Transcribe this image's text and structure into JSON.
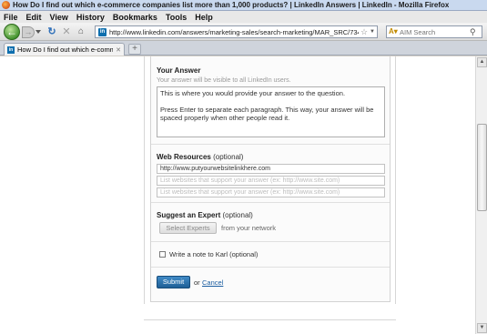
{
  "window": {
    "title": "How Do I find out which e-commerce companies list more than 1,000 products? | LinkedIn Answers | LinkedIn - Mozilla Firefox"
  },
  "menu": {
    "items": [
      "File",
      "Edit",
      "View",
      "History",
      "Bookmarks",
      "Tools",
      "Help"
    ]
  },
  "nav": {
    "url": "http://www.linkedin.com/answers/marketing-sales/search-marketing/MAR_SRC/73491:",
    "search_placeholder": "AIM Search"
  },
  "tabs": {
    "active_label": "How Do I find out which e-comm..."
  },
  "form": {
    "your_answer": {
      "title": "Your Answer",
      "hint": "Your answer will be visible to all LinkedIn users.",
      "text": "This is where you would provide your answer to the question.\n\nPress Enter to separate each paragraph. This way, your answer will be spaced properly when other people read it."
    },
    "web_resources": {
      "title": "Web Resources",
      "optional": "(optional)",
      "inputs": [
        "http://www.putyourwebsitelinkhere.com",
        "List websites that support your answer (ex: http://www.site.com)",
        "List websites that support your answer (ex: http://www.site.com)"
      ]
    },
    "suggest_expert": {
      "title": "Suggest an Expert",
      "optional": "(optional)",
      "button": "Select Experts",
      "network_text": "from your network"
    },
    "note": {
      "label": "Write a note to Karl (optional)",
      "checked": false
    },
    "actions": {
      "submit": "Submit",
      "or": "or",
      "cancel": "Cancel"
    }
  },
  "colors": {
    "submit": "#2a6fac",
    "link": "#1a5da0"
  }
}
